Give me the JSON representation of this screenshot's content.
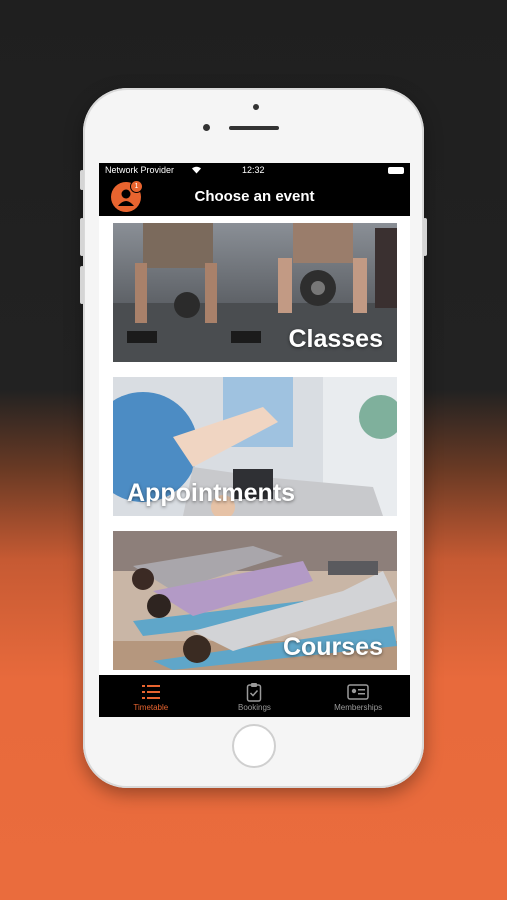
{
  "status_bar": {
    "carrier": "Network Provider",
    "time": "12:32"
  },
  "header": {
    "title": "Choose an event",
    "badge_count": "1"
  },
  "events": [
    {
      "label": "Classes"
    },
    {
      "label": "Appointments"
    },
    {
      "label": "Courses"
    }
  ],
  "tabs": [
    {
      "label": "Timetable",
      "icon": "list-icon",
      "active": true
    },
    {
      "label": "Bookings",
      "icon": "clipboard-icon",
      "active": false
    },
    {
      "label": "Memberships",
      "icon": "id-card-icon",
      "active": false
    }
  ],
  "colors": {
    "accent": "#e8642f",
    "bar": "#000000",
    "background_top": "#222222",
    "background_bottom": "#ea6c3d"
  }
}
